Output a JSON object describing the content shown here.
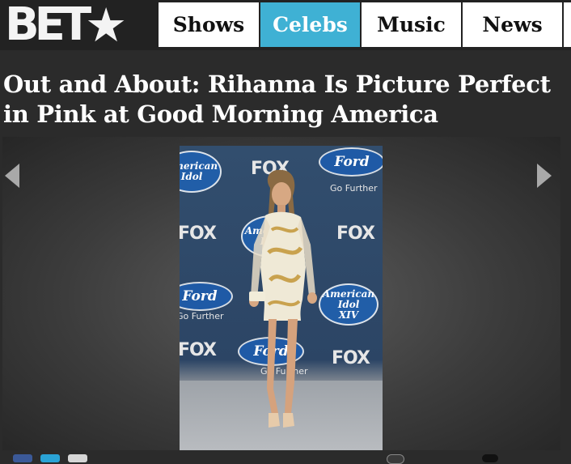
{
  "header": {
    "logo_text": "BET",
    "nav": [
      {
        "label": "Shows",
        "active": false
      },
      {
        "label": "Celebs",
        "active": true
      },
      {
        "label": "Music",
        "active": false
      },
      {
        "label": "News",
        "active": false
      },
      {
        "label": "",
        "active": false
      }
    ]
  },
  "article": {
    "title": "Out and About: Rihanna Is Picture Perfect in Pink at Good Morning America"
  },
  "gallery": {
    "prev_icon": "chevron-left-icon",
    "next_icon": "chevron-right-icon",
    "backdrop": {
      "fox": "FOX",
      "ford": "Ford",
      "ford_tagline": "Go Further",
      "idol_line1": "American",
      "idol_line2": "Idol",
      "idol_line3": "XIV"
    }
  },
  "colors": {
    "page_bg": "#2b2b2b",
    "nav_active": "#3fb1d4",
    "nav_bg": "#ffffff"
  }
}
